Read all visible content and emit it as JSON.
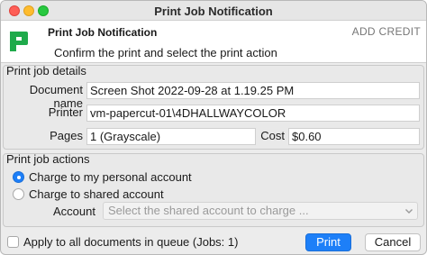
{
  "window": {
    "title": "Print Job Notification"
  },
  "header": {
    "title": "Print Job Notification",
    "subtitle": "Confirm the print and select the print action",
    "add_credit_label": "ADD CREDIT",
    "brand_color": "#1faa4b"
  },
  "details": {
    "legend": "Print job details",
    "document_label": "Document name",
    "document_value": "Screen Shot 2022-09-28 at 1.19.25 PM",
    "printer_label": "Printer",
    "printer_value": "vm-papercut-01\\4DHALLWAYCOLOR",
    "pages_label": "Pages",
    "pages_value": "1  (Grayscale)",
    "cost_label": "Cost",
    "cost_value": "$0.60"
  },
  "actions": {
    "legend": "Print job actions",
    "option_personal": "Charge to my personal account",
    "option_shared": "Charge to shared account",
    "selected_option": "personal",
    "account_label": "Account",
    "account_placeholder": "Select the shared account to charge ..."
  },
  "footer": {
    "apply_all_label": "Apply to all documents in queue (Jobs: 1)",
    "apply_all_checked": false,
    "print_label": "Print",
    "cancel_label": "Cancel"
  },
  "colors": {
    "accent": "#1d7ff8"
  }
}
